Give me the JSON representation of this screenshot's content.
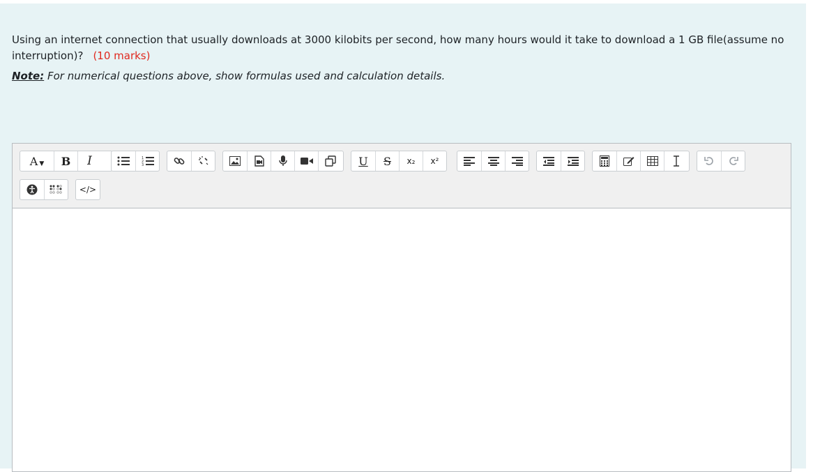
{
  "question": {
    "text": "Using an internet connection that usually downloads at 3000 kilobits per second, how many hours would it take to download a 1 GB file(assume no interruption)?",
    "marks": "(10 marks)"
  },
  "note": {
    "label": "Note:",
    "text": "For numerical questions above, show formulas used and calculation details."
  },
  "toolbar": {
    "font_label": "A",
    "bold_label": "B",
    "italic_label": "I",
    "underline_label": "U",
    "strike_label": "S",
    "subscript_label": "x₂",
    "superscript_label": "x²",
    "html_label": "</>"
  },
  "icons": [
    "font-size-icon",
    "bold-icon",
    "italic-icon",
    "unordered-list-icon",
    "ordered-list-icon",
    "link-icon",
    "unlink-icon",
    "image-icon",
    "media-icon",
    "record-audio-icon",
    "record-video-icon",
    "manage-files-icon",
    "underline-icon",
    "strikethrough-icon",
    "subscript-icon",
    "superscript-icon",
    "align-left-icon",
    "align-center-icon",
    "align-right-icon",
    "outdent-icon",
    "indent-icon",
    "equation-editor-icon",
    "edit-icon",
    "table-icon",
    "clear-formatting-icon",
    "undo-icon",
    "redo-icon",
    "accessibility-checker-icon",
    "screen-reader-helper-icon",
    "html-icon"
  ],
  "editor": {
    "content": ""
  }
}
